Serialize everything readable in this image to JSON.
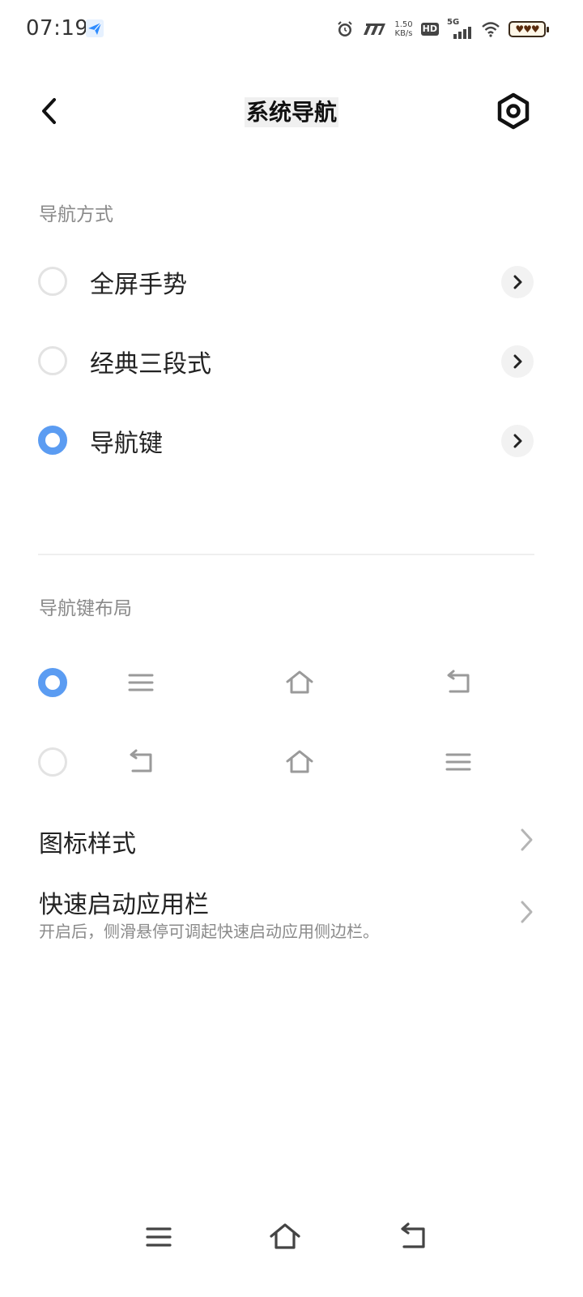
{
  "status_bar": {
    "time": "07:19",
    "net_speed_value": "1.50",
    "net_speed_unit": "KB/s",
    "hd_label": "HD",
    "signal_label": "5G",
    "icons": [
      "alarm-icon",
      "nfc-icon",
      "hd-icon",
      "5g-signal-icon",
      "wifi-icon",
      "battery-icon"
    ]
  },
  "header": {
    "title": "系统导航",
    "back_icon": "chevron-left-icon",
    "settings_icon": "settings-icon"
  },
  "nav_mode": {
    "section_title": "导航方式",
    "options": [
      {
        "label": "全屏手势",
        "selected": false
      },
      {
        "label": "经典三段式",
        "selected": false
      },
      {
        "label": "导航键",
        "selected": true
      }
    ]
  },
  "nav_layout": {
    "section_title": "导航键布局",
    "layouts": [
      {
        "selected": true,
        "buttons": [
          "menu-icon",
          "home-icon",
          "back-icon"
        ]
      },
      {
        "selected": false,
        "buttons": [
          "back-icon",
          "home-icon",
          "menu-icon"
        ]
      }
    ]
  },
  "menu": {
    "icon_style": {
      "title": "图标样式"
    },
    "quick_launch": {
      "title": "快速启动应用栏",
      "subtitle": "开启后，侧滑悬停可调起快速启动应用侧边栏。"
    }
  },
  "system_nav": {
    "buttons": [
      "menu-icon",
      "home-icon",
      "back-icon"
    ]
  },
  "colors": {
    "accent": "#5b9cf2",
    "section_text": "#8a8a8a",
    "primary_text": "#222222",
    "radio_border": "#e3e3e3"
  }
}
